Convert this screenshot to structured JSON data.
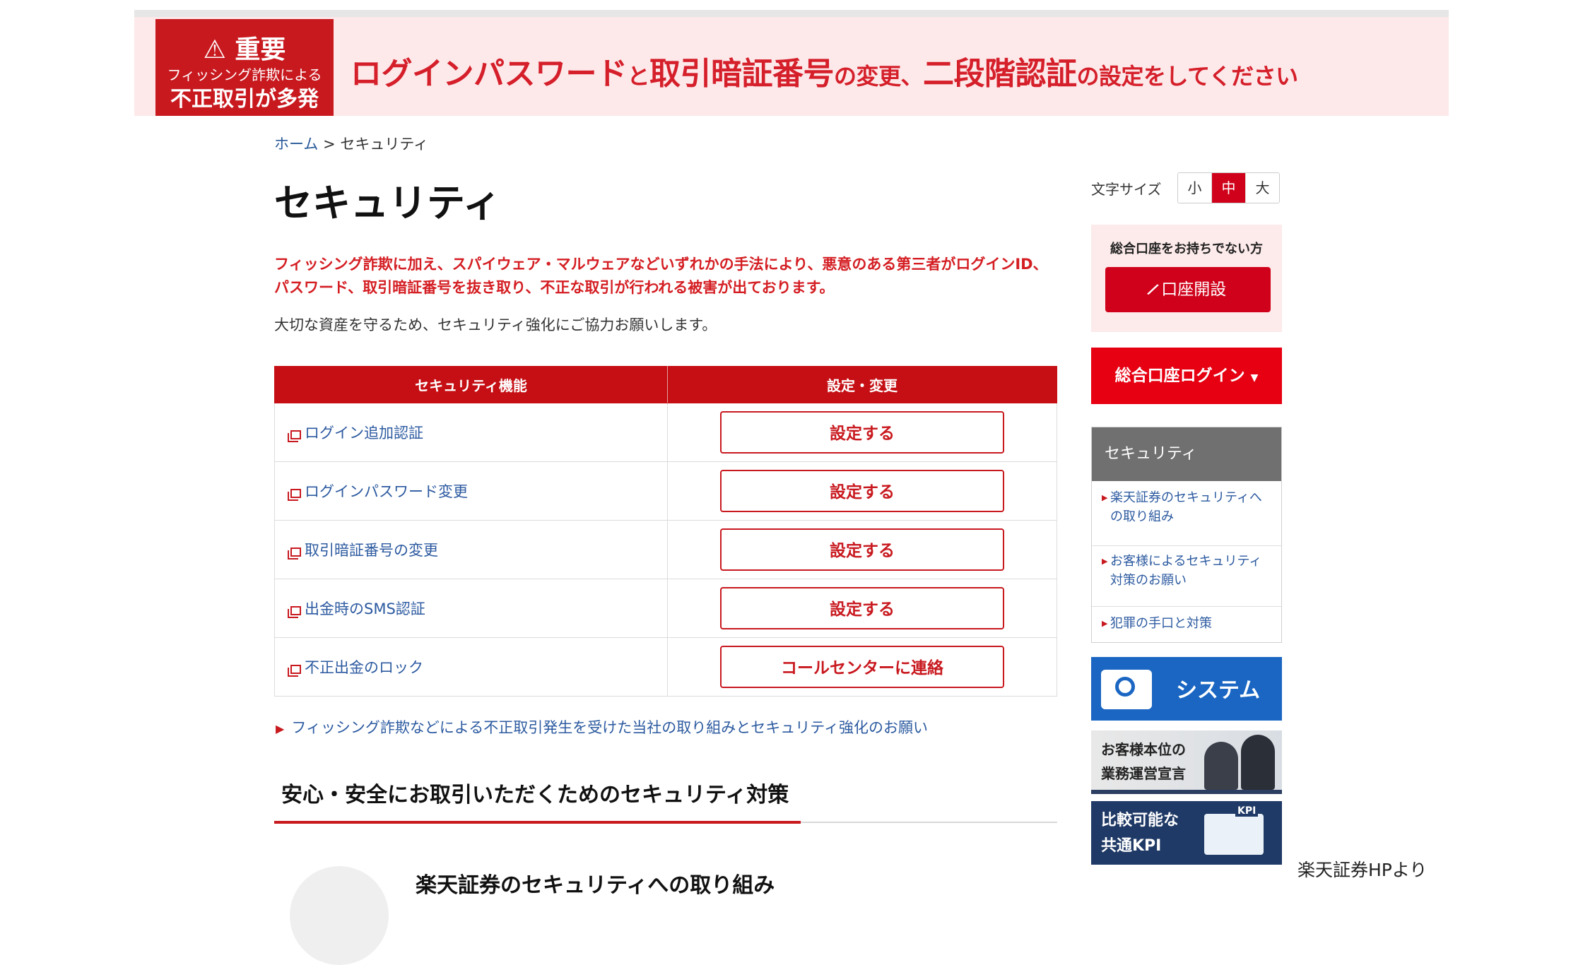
{
  "banner": {
    "badge_title": "重要",
    "badge_sub": "フィッシング詐欺による",
    "badge_main": "不正取引が多発",
    "text_a": "ログインパスワード",
    "text_b": "と",
    "text_c": "取引暗証番号",
    "text_d": "の変更、",
    "text_e": "二段階認証",
    "text_f": "の設定をしてください"
  },
  "breadcrumb": {
    "home": "ホーム",
    "sep": ">",
    "current": "セキュリティ"
  },
  "page_title": "セキュリティ",
  "warning_text": "フィッシング詐欺に加え、スパイウェア・マルウェアなどいずれかの手法により、悪意のある第三者がログインID、パスワード、取引暗証番号を抜き取り、不正な取引が行われる被害が出ております。",
  "intro_text": "大切な資産を守るため、セキュリティ強化にご協力お願いします。",
  "table": {
    "headers": [
      "セキュリティ機能",
      "設定・変更"
    ],
    "rows": [
      {
        "feature": "ログイン追加認証",
        "action": "設定する"
      },
      {
        "feature": "ログインパスワード変更",
        "action": "設定する"
      },
      {
        "feature": "取引暗証番号の変更",
        "action": "設定する"
      },
      {
        "feature": "出金時のSMS認証",
        "action": "設定する"
      },
      {
        "feature": "不正出金のロック",
        "action": "コールセンターに連絡"
      }
    ]
  },
  "notice_link": "フィッシング詐欺などによる不正取引発生を受けた当社の取り組みとセキュリティ強化のお願い",
  "section_heading": "安心・安全にお取引いただくためのセキュリティ対策",
  "sub_heading": "楽天証券のセキュリティへの取り組み",
  "sidebar": {
    "font_size_label": "文字サイズ",
    "font_sizes": [
      "小",
      "中",
      "大"
    ],
    "font_size_active": "中",
    "no_account_label": "総合口座をお持ちでない方",
    "open_account_button": "口座開設",
    "login_button": "総合口座ログイン",
    "nav_header": "セキュリティ",
    "nav_items": [
      "楽天証券のセキュリティへの取り組み",
      "お客様によるセキュリティ対策のお願い",
      "犯罪の手口と対策"
    ],
    "promo_system": "システム",
    "promo_customer_line1": "お客様本位の",
    "promo_customer_line2": "業務運営宣言",
    "promo_kpi_line1": "比較可能な",
    "promo_kpi_line2": "共通KPI",
    "promo_kpi_tag": "KPI"
  },
  "credit": "楽天証券HPより",
  "colors": {
    "accent": "#c8191f",
    "link": "#2c5aa0",
    "banner_bg": "#fde9ea"
  }
}
